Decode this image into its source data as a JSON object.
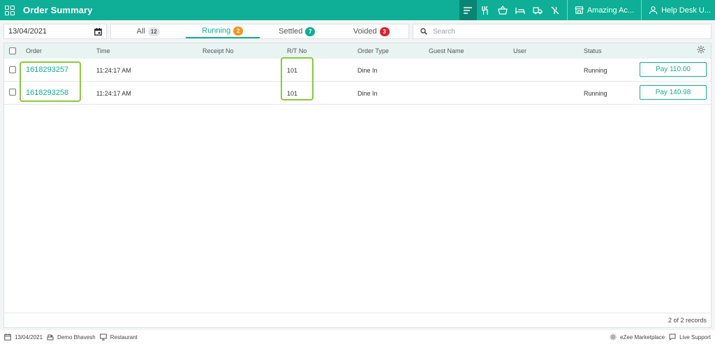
{
  "app": {
    "title": "Order Summary"
  },
  "toolbar": {
    "property_label": "Amazing Ac...",
    "helpdesk_label": "Help Desk U..."
  },
  "filter": {
    "date": "13/04/2021",
    "tabs": [
      {
        "label": "All",
        "count": "12",
        "badge_color": "#e4e6e8",
        "badge_text_color": "#555555"
      },
      {
        "label": "Running",
        "count": "2",
        "badge_color": "#f7941d",
        "badge_text_color": "#ffffff"
      },
      {
        "label": "Settled",
        "count": "7",
        "badge_color": "#0fae96",
        "badge_text_color": "#ffffff"
      },
      {
        "label": "Voided",
        "count": "3",
        "badge_color": "#d9232d",
        "badge_text_color": "#ffffff"
      }
    ],
    "search_placeholder": "Search"
  },
  "table": {
    "columns": [
      "Order",
      "Time",
      "Receipt No",
      "R/T No",
      "Order Type",
      "Guest Name",
      "User",
      "Status"
    ],
    "rows": [
      {
        "order": "1618293257",
        "time": "11:24:17 AM",
        "receipt": "",
        "rt": "101",
        "type": "Dine In",
        "guest": "",
        "user": "",
        "status": "Running",
        "pay": "Pay 110.00"
      },
      {
        "order": "1618293258",
        "time": "11:24:17 AM",
        "receipt": "",
        "rt": "101",
        "type": "Dine In",
        "guest": "",
        "user": "",
        "status": "Running",
        "pay": "Pay 140.98"
      }
    ],
    "records": "2 of 2 records"
  },
  "statusbar": {
    "date": "13/04/2021",
    "user": "Demo Bhavesh",
    "outlet": "Restaurant",
    "marketplace": "eZee Marketplace",
    "support": "Live Support"
  },
  "colors": {
    "accent": "#0fae96",
    "highlight": "#8cc63f"
  }
}
